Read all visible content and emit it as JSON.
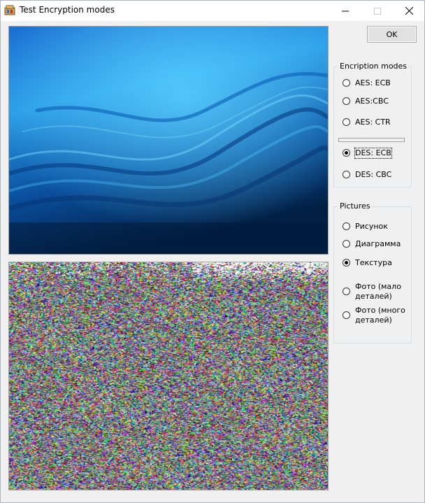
{
  "window": {
    "title": "Test Encryption modes"
  },
  "buttons": {
    "ok_label": "OK"
  },
  "encryption_modes": {
    "label": "Encription modes",
    "options": [
      {
        "label": "AES: ECB",
        "checked": false
      },
      {
        "label": "AES:CBC",
        "checked": false
      },
      {
        "label": "AES: CTR",
        "checked": false
      },
      {
        "label": "DES: ECB",
        "checked": true
      },
      {
        "label": "DES: CBC",
        "checked": false
      }
    ]
  },
  "pictures": {
    "label": "Pictures",
    "options": [
      {
        "label": "Рисунок",
        "checked": false
      },
      {
        "label": "Диаграмма",
        "checked": false
      },
      {
        "label": "Текстура",
        "checked": true
      },
      {
        "label": "Фото (мало деталей)",
        "checked": false
      },
      {
        "label": "Фото (много деталей)",
        "checked": false
      }
    ]
  },
  "colors": {
    "accent": "#1e88d8",
    "titlebar": "#ffffff",
    "window_bg": "#f0f0f0"
  }
}
